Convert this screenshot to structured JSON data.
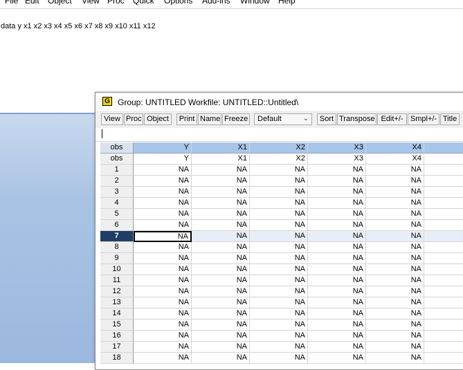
{
  "menu": [
    "File",
    "Edit",
    "Object",
    "View",
    "Proc",
    "Quick",
    "Options",
    "Add-ins",
    "Window",
    "Help"
  ],
  "command": "data y x1 x2 x3 x4 x5 x6 x7 x8 x9 x10 x11 x12",
  "window": {
    "icon_letter": "G",
    "title": "Group: UNTITLED   Workfile: UNTITLED::Untitled\\"
  },
  "toolbar": {
    "buttons": [
      "View",
      "Proc",
      "Object",
      "Print",
      "Name",
      "Freeze",
      "Sort",
      "Transpose",
      "Edit+/-",
      "Smpl+/-",
      "Title"
    ],
    "display_select": "Default"
  },
  "grid": {
    "header": [
      "obs",
      "Y",
      "X1",
      "X2",
      "X3",
      "X4",
      ""
    ],
    "name_row": [
      "obs",
      "Y",
      "X1",
      "X2",
      "X3",
      "X4",
      ""
    ],
    "rows": [
      [
        "1",
        "NA",
        "NA",
        "NA",
        "NA",
        "NA",
        ""
      ],
      [
        "2",
        "NA",
        "NA",
        "NA",
        "NA",
        "NA",
        ""
      ],
      [
        "3",
        "NA",
        "NA",
        "NA",
        "NA",
        "NA",
        ""
      ],
      [
        "4",
        "NA",
        "NA",
        "NA",
        "NA",
        "NA",
        ""
      ],
      [
        "5",
        "NA",
        "NA",
        "NA",
        "NA",
        "NA",
        ""
      ],
      [
        "6",
        "NA",
        "NA",
        "NA",
        "NA",
        "NA",
        ""
      ],
      [
        "7",
        "NA",
        "NA",
        "NA",
        "NA",
        "NA",
        ""
      ],
      [
        "8",
        "NA",
        "NA",
        "NA",
        "NA",
        "NA",
        ""
      ],
      [
        "9",
        "NA",
        "NA",
        "NA",
        "NA",
        "NA",
        ""
      ],
      [
        "10",
        "NA",
        "NA",
        "NA",
        "NA",
        "NA",
        ""
      ],
      [
        "11",
        "NA",
        "NA",
        "NA",
        "NA",
        "NA",
        ""
      ],
      [
        "12",
        "NA",
        "NA",
        "NA",
        "NA",
        "NA",
        ""
      ],
      [
        "13",
        "NA",
        "NA",
        "NA",
        "NA",
        "NA",
        ""
      ],
      [
        "14",
        "NA",
        "NA",
        "NA",
        "NA",
        "NA",
        ""
      ],
      [
        "15",
        "NA",
        "NA",
        "NA",
        "NA",
        "NA",
        ""
      ],
      [
        "16",
        "NA",
        "NA",
        "NA",
        "NA",
        "NA",
        ""
      ],
      [
        "17",
        "NA",
        "NA",
        "NA",
        "NA",
        "NA",
        ""
      ],
      [
        "18",
        "NA",
        "NA",
        "NA",
        "NA",
        "NA",
        ""
      ]
    ],
    "selected_obs": "7"
  }
}
